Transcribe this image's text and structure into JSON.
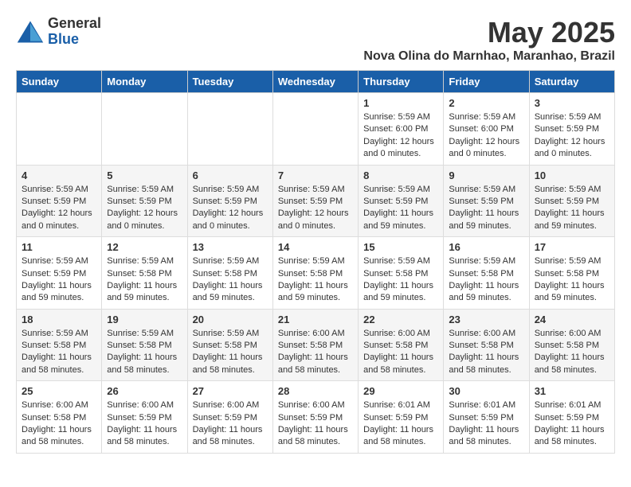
{
  "logo": {
    "general": "General",
    "blue": "Blue"
  },
  "title": {
    "month": "May 2025",
    "location": "Nova Olina do Marnhao, Maranhao, Brazil"
  },
  "days_of_week": [
    "Sunday",
    "Monday",
    "Tuesday",
    "Wednesday",
    "Thursday",
    "Friday",
    "Saturday"
  ],
  "weeks": [
    [
      {
        "day": "",
        "info": ""
      },
      {
        "day": "",
        "info": ""
      },
      {
        "day": "",
        "info": ""
      },
      {
        "day": "",
        "info": ""
      },
      {
        "day": "1",
        "info": "Sunrise: 5:59 AM\nSunset: 6:00 PM\nDaylight: 12 hours\nand 0 minutes."
      },
      {
        "day": "2",
        "info": "Sunrise: 5:59 AM\nSunset: 6:00 PM\nDaylight: 12 hours\nand 0 minutes."
      },
      {
        "day": "3",
        "info": "Sunrise: 5:59 AM\nSunset: 5:59 PM\nDaylight: 12 hours\nand 0 minutes."
      }
    ],
    [
      {
        "day": "4",
        "info": "Sunrise: 5:59 AM\nSunset: 5:59 PM\nDaylight: 12 hours\nand 0 minutes."
      },
      {
        "day": "5",
        "info": "Sunrise: 5:59 AM\nSunset: 5:59 PM\nDaylight: 12 hours\nand 0 minutes."
      },
      {
        "day": "6",
        "info": "Sunrise: 5:59 AM\nSunset: 5:59 PM\nDaylight: 12 hours\nand 0 minutes."
      },
      {
        "day": "7",
        "info": "Sunrise: 5:59 AM\nSunset: 5:59 PM\nDaylight: 12 hours\nand 0 minutes."
      },
      {
        "day": "8",
        "info": "Sunrise: 5:59 AM\nSunset: 5:59 PM\nDaylight: 11 hours\nand 59 minutes."
      },
      {
        "day": "9",
        "info": "Sunrise: 5:59 AM\nSunset: 5:59 PM\nDaylight: 11 hours\nand 59 minutes."
      },
      {
        "day": "10",
        "info": "Sunrise: 5:59 AM\nSunset: 5:59 PM\nDaylight: 11 hours\nand 59 minutes."
      }
    ],
    [
      {
        "day": "11",
        "info": "Sunrise: 5:59 AM\nSunset: 5:59 PM\nDaylight: 11 hours\nand 59 minutes."
      },
      {
        "day": "12",
        "info": "Sunrise: 5:59 AM\nSunset: 5:58 PM\nDaylight: 11 hours\nand 59 minutes."
      },
      {
        "day": "13",
        "info": "Sunrise: 5:59 AM\nSunset: 5:58 PM\nDaylight: 11 hours\nand 59 minutes."
      },
      {
        "day": "14",
        "info": "Sunrise: 5:59 AM\nSunset: 5:58 PM\nDaylight: 11 hours\nand 59 minutes."
      },
      {
        "day": "15",
        "info": "Sunrise: 5:59 AM\nSunset: 5:58 PM\nDaylight: 11 hours\nand 59 minutes."
      },
      {
        "day": "16",
        "info": "Sunrise: 5:59 AM\nSunset: 5:58 PM\nDaylight: 11 hours\nand 59 minutes."
      },
      {
        "day": "17",
        "info": "Sunrise: 5:59 AM\nSunset: 5:58 PM\nDaylight: 11 hours\nand 59 minutes."
      }
    ],
    [
      {
        "day": "18",
        "info": "Sunrise: 5:59 AM\nSunset: 5:58 PM\nDaylight: 11 hours\nand 58 minutes."
      },
      {
        "day": "19",
        "info": "Sunrise: 5:59 AM\nSunset: 5:58 PM\nDaylight: 11 hours\nand 58 minutes."
      },
      {
        "day": "20",
        "info": "Sunrise: 5:59 AM\nSunset: 5:58 PM\nDaylight: 11 hours\nand 58 minutes."
      },
      {
        "day": "21",
        "info": "Sunrise: 6:00 AM\nSunset: 5:58 PM\nDaylight: 11 hours\nand 58 minutes."
      },
      {
        "day": "22",
        "info": "Sunrise: 6:00 AM\nSunset: 5:58 PM\nDaylight: 11 hours\nand 58 minutes."
      },
      {
        "day": "23",
        "info": "Sunrise: 6:00 AM\nSunset: 5:58 PM\nDaylight: 11 hours\nand 58 minutes."
      },
      {
        "day": "24",
        "info": "Sunrise: 6:00 AM\nSunset: 5:58 PM\nDaylight: 11 hours\nand 58 minutes."
      }
    ],
    [
      {
        "day": "25",
        "info": "Sunrise: 6:00 AM\nSunset: 5:58 PM\nDaylight: 11 hours\nand 58 minutes."
      },
      {
        "day": "26",
        "info": "Sunrise: 6:00 AM\nSunset: 5:59 PM\nDaylight: 11 hours\nand 58 minutes."
      },
      {
        "day": "27",
        "info": "Sunrise: 6:00 AM\nSunset: 5:59 PM\nDaylight: 11 hours\nand 58 minutes."
      },
      {
        "day": "28",
        "info": "Sunrise: 6:00 AM\nSunset: 5:59 PM\nDaylight: 11 hours\nand 58 minutes."
      },
      {
        "day": "29",
        "info": "Sunrise: 6:01 AM\nSunset: 5:59 PM\nDaylight: 11 hours\nand 58 minutes."
      },
      {
        "day": "30",
        "info": "Sunrise: 6:01 AM\nSunset: 5:59 PM\nDaylight: 11 hours\nand 58 minutes."
      },
      {
        "day": "31",
        "info": "Sunrise: 6:01 AM\nSunset: 5:59 PM\nDaylight: 11 hours\nand 58 minutes."
      }
    ]
  ]
}
